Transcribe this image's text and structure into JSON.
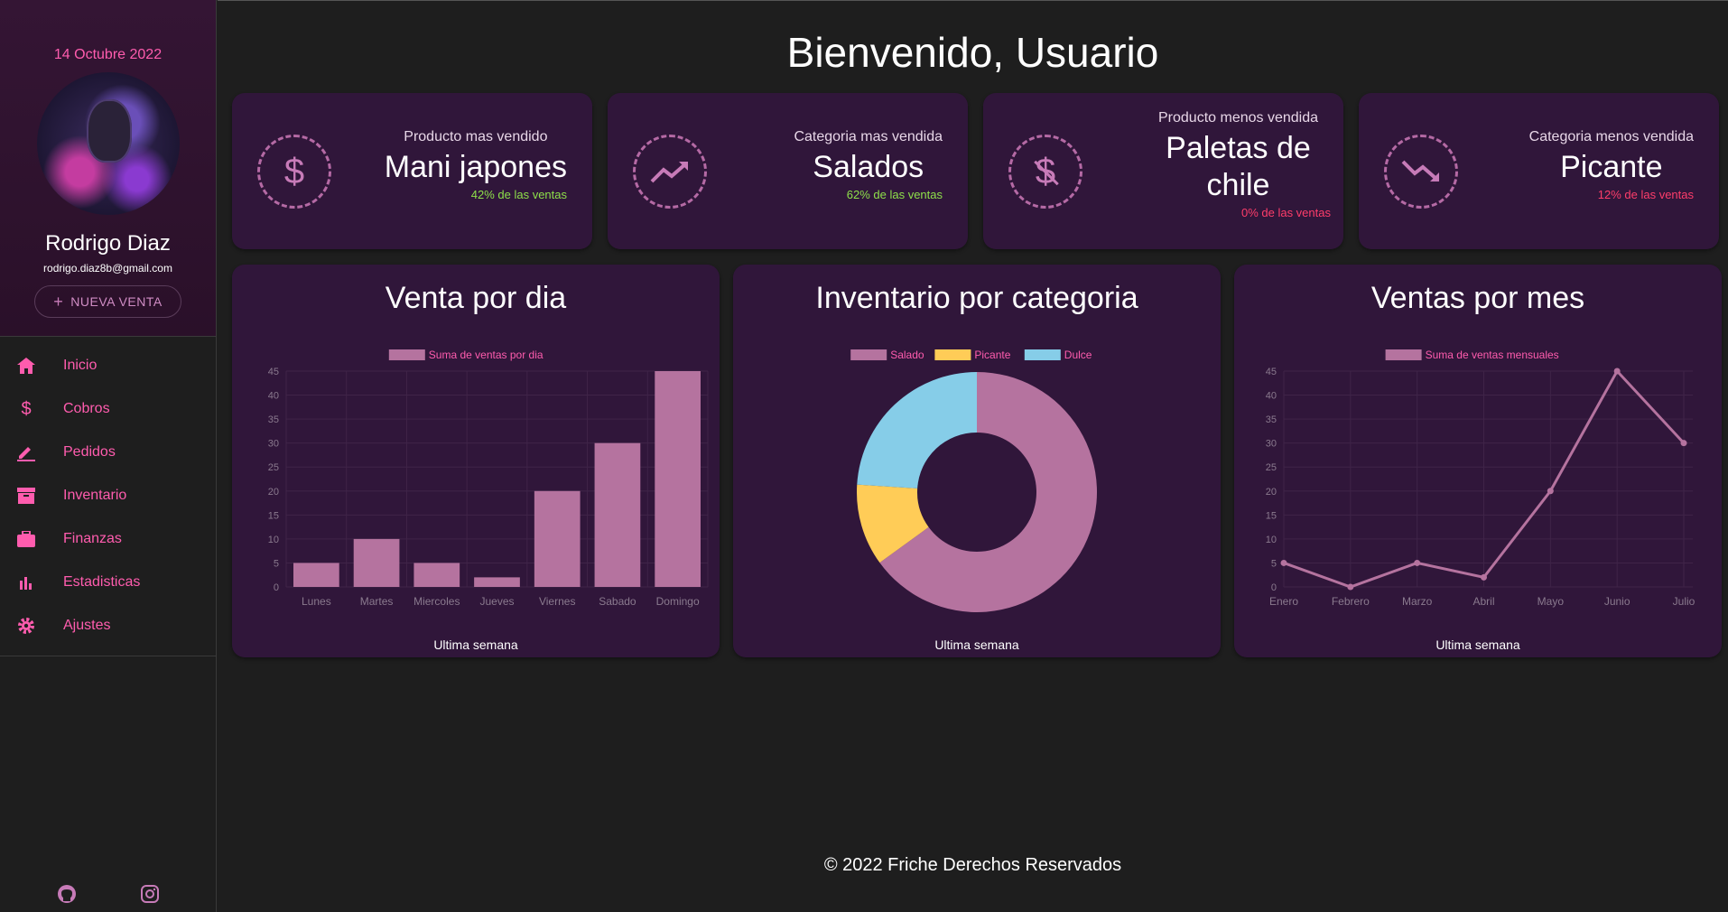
{
  "sidebar": {
    "date": "14 Octubre 2022",
    "user_name": "Rodrigo Diaz",
    "user_email": "rodrigo.diaz8b@gmail.com",
    "new_sale_label": "NUEVA VENTA",
    "items": [
      {
        "label": "Inicio",
        "icon": "home-icon"
      },
      {
        "label": "Cobros",
        "icon": "dollar-icon"
      },
      {
        "label": "Pedidos",
        "icon": "edit-icon"
      },
      {
        "label": "Inventario",
        "icon": "archive-icon"
      },
      {
        "label": "Finanzas",
        "icon": "briefcase-icon"
      },
      {
        "label": "Estadisticas",
        "icon": "bar-chart-icon"
      },
      {
        "label": "Ajustes",
        "icon": "gear-icon"
      }
    ],
    "social": [
      "github-icon",
      "instagram-icon"
    ]
  },
  "header": {
    "title": "Bienvenido, Usuario"
  },
  "stats": [
    {
      "subtitle": "Producto mas vendido",
      "value": "Mani japones",
      "pct": "42% de las ventas",
      "icon": "dollar-icon",
      "pct_color": "#8ee04a"
    },
    {
      "subtitle": "Categoria mas vendida",
      "value": "Salados",
      "pct": "62% de las ventas",
      "icon": "trending-up-icon",
      "pct_color": "#8ee04a"
    },
    {
      "subtitle": "Producto menos vendida",
      "value_line1": "Paletas de",
      "value_line2": "chile",
      "pct": "0% de las ventas",
      "icon": "no-money-icon",
      "pct_color": "#ff3d6b"
    },
    {
      "subtitle": "Categoria menos vendida",
      "value": "Picante",
      "pct": "12% de las ventas",
      "icon": "trending-down-icon",
      "pct_color": "#ff3d6b"
    }
  ],
  "charts": {
    "daily_title": "Venta por dia",
    "category_title": "Inventario por categoria",
    "monthly_title": "Ventas por mes",
    "footer_label": "Ultima semana"
  },
  "colors": {
    "accent": "#ff5cae",
    "bar": "#b5739f",
    "salado": "#b5739f",
    "picante": "#ffcc57",
    "dulce": "#86cde8"
  },
  "chart_data": [
    {
      "type": "bar",
      "title": "Venta por dia",
      "categories": [
        "Lunes",
        "Martes",
        "Miercoles",
        "Jueves",
        "Viernes",
        "Sabado",
        "Domingo"
      ],
      "series": [
        {
          "name": "Suma de ventas por dia",
          "values": [
            5,
            10,
            5,
            2,
            20,
            30,
            45
          ]
        }
      ],
      "ylim": [
        0,
        45
      ],
      "yticks": [
        0,
        5,
        10,
        15,
        20,
        25,
        30,
        35,
        40,
        45
      ],
      "grid": true,
      "legend": "top",
      "xlabel": "Ultima semana"
    },
    {
      "type": "pie",
      "title": "Inventario por categoria",
      "categories": [
        "Salado",
        "Picante",
        "Dulce"
      ],
      "values": [
        65,
        11,
        24
      ],
      "legend": "top",
      "xlabel": "Ultima semana"
    },
    {
      "type": "line",
      "title": "Ventas por mes",
      "categories": [
        "Enero",
        "Febrero",
        "Marzo",
        "Abril",
        "Mayo",
        "Junio",
        "Julio"
      ],
      "series": [
        {
          "name": "Suma de ventas mensuales",
          "values": [
            5,
            0,
            5,
            2,
            20,
            45,
            30
          ]
        }
      ],
      "ylim": [
        0,
        45
      ],
      "yticks": [
        0,
        5,
        10,
        15,
        20,
        25,
        30,
        35,
        40,
        45
      ],
      "grid": true,
      "legend": "top",
      "xlabel": "Ultima semana"
    }
  ],
  "footer": {
    "text": "© 2022 Friche Derechos Reservados"
  }
}
